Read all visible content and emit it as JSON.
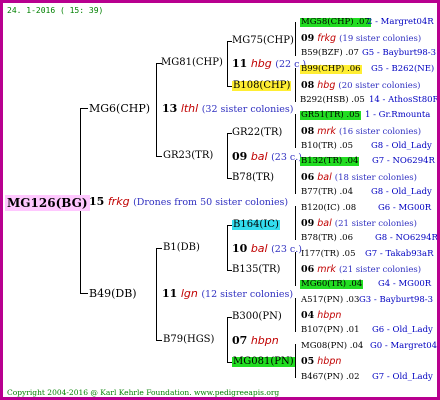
{
  "date": "24. 1-2016 ( 15: 39)",
  "copyright": "Copyright 2004-2016 @ Karl Kehrle Foundation.   www.pedigreeapis.org",
  "root": {
    "name": "MG126(BG)",
    "num": "15",
    "code": "frkg",
    "desc": "(Drones from 50 sister colonies)"
  },
  "l1": [
    {
      "name": "MG6(CHP)",
      "num": "13",
      "code": "lthl",
      "desc": "(32 sister colonies)"
    },
    {
      "name": "B49(DB)",
      "num": "11",
      "code": "lgn",
      "desc": "(12 sister colonies)"
    }
  ],
  "l2": [
    {
      "name": "MG81(CHP)",
      "num": "11",
      "code": "hbg",
      "desc": "(22 c.)"
    },
    {
      "name": "GR23(TR)",
      "num": "09",
      "code": "bal",
      "desc": "(23 c.)"
    },
    {
      "name": "B1(DB)",
      "num": "10",
      "code": "bal",
      "desc": "(23 c.)"
    },
    {
      "name": "B79(HGS)",
      "num": "07",
      "code": "hbpn",
      "desc": ""
    }
  ],
  "l3": [
    {
      "name": "MG75(CHP)"
    },
    {
      "name": "B108(CHP)"
    },
    {
      "name": "GR22(TR)"
    },
    {
      "name": "B78(TR)"
    },
    {
      "name": "B164(IC)"
    },
    {
      "name": "B135(TR)"
    },
    {
      "name": "B300(PN)"
    },
    {
      "name": "MG081(PN)"
    }
  ],
  "l4": [
    {
      "a": "MG58(CHP) .07",
      "ar": "2 - Margret04R",
      "num": "09",
      "code": "frkg",
      "desc": "(19 sister colonies)",
      "b": "B59(BZF) .07",
      "br": "G5 - Bayburt98-3"
    },
    {
      "a": "B99(CHP) .06",
      "ar": "G5 - B262(NE)",
      "num": "08",
      "code": "hbg",
      "desc": "(20 sister colonies)",
      "b": "B292(HSB) .05",
      "br": "14 - AthosSt80R"
    },
    {
      "a": "GR51(TR) .05",
      "ar": "1 - Gr.Rmounta",
      "num": "08",
      "code": "mrk",
      "desc": "(16 sister colonies)",
      "b": "B10(TR) .05",
      "br": "G8 - Old_Lady"
    },
    {
      "a": "B132(TR) .04",
      "ar": "G7 - NO6294R",
      "num": "06",
      "code": "bal",
      "desc": "(18 sister colonies)",
      "b": "B77(TR) .04",
      "br": "G8 - Old_Lady"
    },
    {
      "a": "B120(IC) .08",
      "ar": "G6 - MG00R",
      "num": "09",
      "code": "bal",
      "desc": "(21 sister colonies)",
      "b": "B78(TR) .06",
      "br": "G8 - NO6294R"
    },
    {
      "a": "I177(TR) .05",
      "ar": "G7 - Takab93aR",
      "num": "06",
      "code": "mrk",
      "desc": "(21 sister colonies)",
      "b": "MG60(TR) .04",
      "br": "G4 - MG00R"
    },
    {
      "a": "A517(PN) .03",
      "ar": "G3 - Bayburt98-3",
      "num": "04",
      "code": "hbpn",
      "desc": "",
      "b": "B107(PN) .01",
      "br": "G6 - Old_Lady"
    },
    {
      "a": "MG08(PN) .04",
      "ar": "G0 - Margret04R",
      "num": "05",
      "code": "hbpn",
      "desc": "",
      "b": "B467(PN) .02",
      "br": "G7 - Old_Lady"
    }
  ]
}
